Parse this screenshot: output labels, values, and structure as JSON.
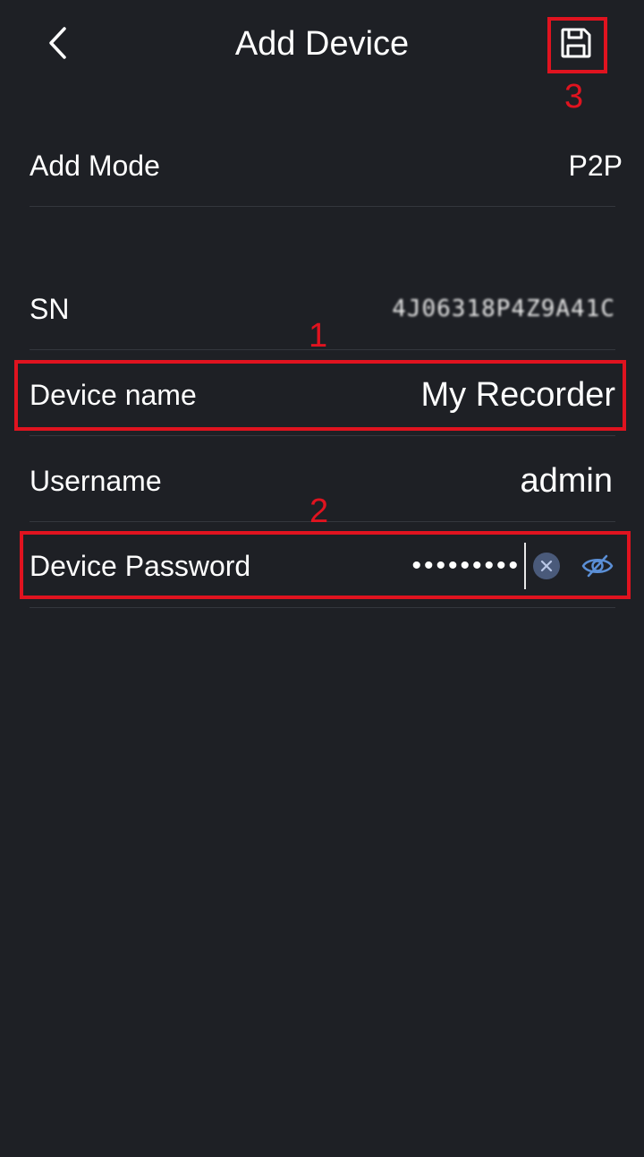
{
  "header": {
    "title": "Add Device",
    "back_icon": "chevron-left-icon",
    "save_icon": "floppy-disk-icon"
  },
  "rows": {
    "add_mode": {
      "label": "Add Mode",
      "value": "P2P"
    },
    "sn": {
      "label": "SN",
      "value": "4J06318P4Z9A41C"
    },
    "device_name": {
      "label": "Device name",
      "value": "My Recorder"
    },
    "username": {
      "label": "Username",
      "value": "admin"
    },
    "password": {
      "label": "Device Password",
      "value": "•••••••••"
    }
  },
  "annotations": {
    "one": "1",
    "two": "2",
    "three": "3"
  },
  "colors": {
    "background": "#1e2025",
    "text": "#ffffff",
    "divider": "#34373d",
    "annotation": "#e0131f",
    "accent": "#5b8fd6"
  }
}
